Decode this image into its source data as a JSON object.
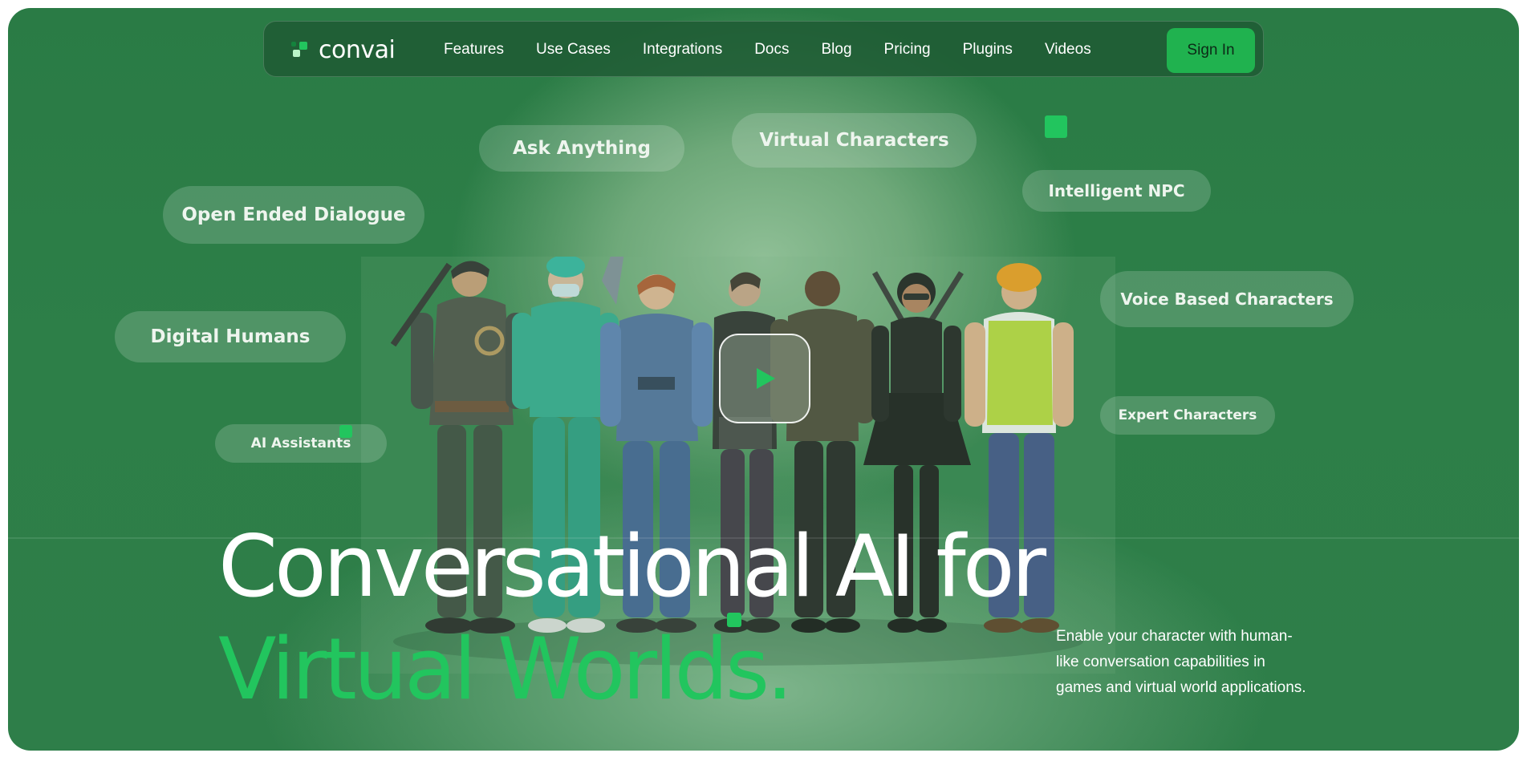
{
  "brand": {
    "name": "convai"
  },
  "nav": {
    "links": [
      "Features",
      "Use Cases",
      "Integrations",
      "Docs",
      "Blog",
      "Pricing",
      "Plugins",
      "Videos"
    ],
    "signin_label": "Sign In"
  },
  "tags": {
    "ask_anything": "Ask Anything",
    "virtual_characters": "Virtual Characters",
    "intelligent_npc": "Intelligent NPC",
    "open_ended_dialogue": "Open Ended Dialogue",
    "digital_humans": "Digital Humans",
    "voice_based_characters": "Voice Based Characters",
    "expert_characters": "Expert Characters",
    "ai_assistants": "AI Assistants"
  },
  "hero": {
    "headline_line1": "Conversational AI for",
    "headline_line2": "Virtual Worlds.",
    "description": "Enable your character with human-like conversation capabilities in games and virtual world applications."
  },
  "colors": {
    "accent": "#22c55e",
    "background": "#2d7e48",
    "signin_bg": "#20b24f"
  },
  "icons": [
    "logo-mark-icon",
    "play-icon"
  ]
}
